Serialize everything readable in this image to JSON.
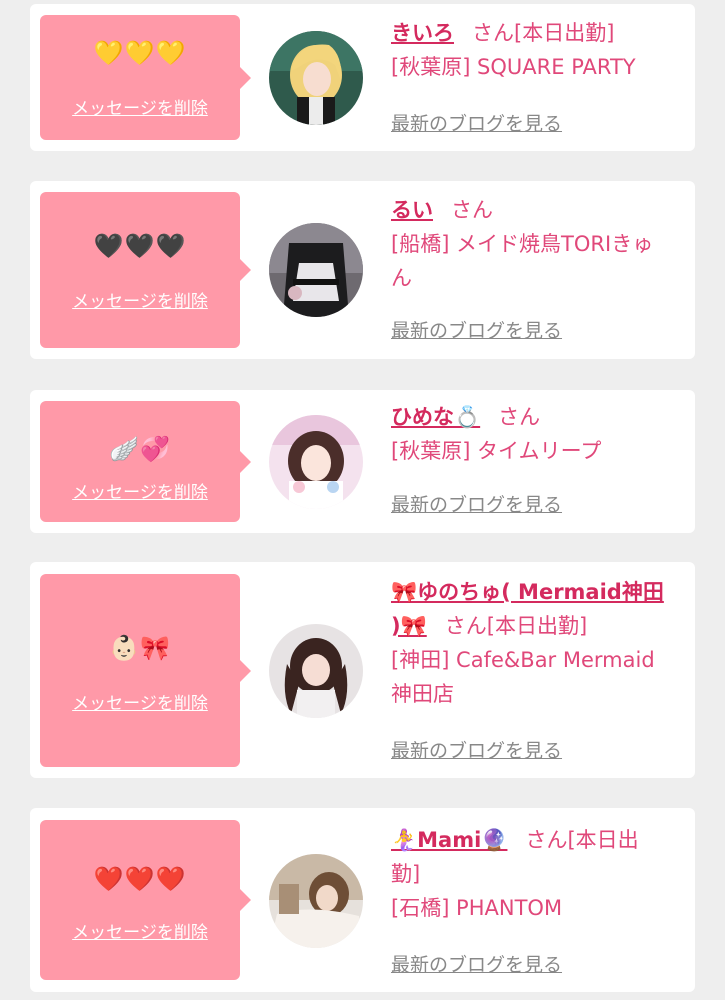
{
  "delete_label": "メッセージを削除",
  "blog_label": "最新のブログを見る",
  "honorific": "さん",
  "working_today": "[本日出勤]",
  "colors": {
    "card_bg": "#ffffff",
    "page_bg": "#eeeeee",
    "message_box": "#ff99a8",
    "name_link": "#d42a5e",
    "text_pink": "#e0487a",
    "blog_link": "#888888"
  },
  "entries": [
    {
      "emojis": "💛💛💛",
      "name": "きいろ",
      "status": "[本日出勤]",
      "shop": "[秋葉原] SQUARE PARTY",
      "avatar_icon": "blonde-cosplay-photo"
    },
    {
      "emojis": "🖤🖤🖤",
      "name": "るい",
      "status": "",
      "shop_line1": "[船橋] メイド焼鳥TORIきゅ",
      "shop_line2": "ん",
      "avatar_icon": "maid-outfit-photo"
    },
    {
      "emojis": "🪽💞",
      "name": "ひめな💍",
      "status": "",
      "shop": "[秋葉原] タイムリープ",
      "avatar_icon": "pastel-idol-photo"
    },
    {
      "emojis": "👶🏻🎀",
      "name_line1": "🎀ゆのちゅ( Mermaid神田",
      "name_line2": ")🎀",
      "status": "[本日出勤]",
      "shop_line1": "[神田] Cafe&Bar Mermaid",
      "shop_line2": "神田店",
      "avatar_icon": "twin-tails-photo"
    },
    {
      "emojis": "❤️❤️❤️",
      "name": "🧜‍♀️Mami🔮",
      "status_line1": "[本日出",
      "status_line2": "勤]",
      "shop": "[石橋] PHANTOM",
      "avatar_icon": "sofa-portrait-photo"
    }
  ]
}
